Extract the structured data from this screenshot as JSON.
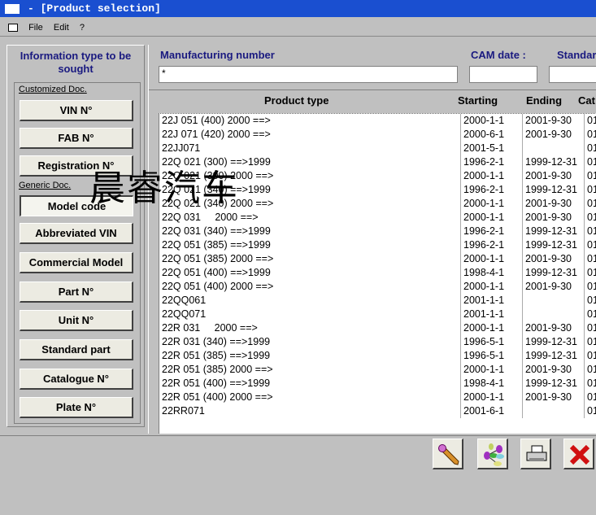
{
  "window": {
    "title": "- [Product selection]"
  },
  "menu": {
    "items": [
      "File",
      "Edit",
      "?"
    ]
  },
  "left_panel": {
    "title": "Information type to be sought",
    "customized_label": "Customized Doc.",
    "generic_label": "Generic Doc.",
    "customized_buttons": [
      "VIN N°",
      "FAB N°",
      "Registration N°"
    ],
    "generic_buttons": [
      "Model code",
      "Abbreviated VIN",
      "Commercial Model",
      "Part N°",
      "Unit N°",
      "Standard part",
      "Catalogue N°",
      "Plate N°"
    ],
    "selected": "Model code"
  },
  "search": {
    "manufacturing_number_label": "Manufacturing number",
    "manufacturing_number_value": "*",
    "cam_date_label": "CAM date :",
    "cam_date_value": "",
    "standard_label": "Standar",
    "standard_value": ""
  },
  "grid": {
    "headers": [
      "Product type",
      "Starting",
      "Ending",
      "Cat"
    ],
    "rows": [
      [
        "22J 051 (400) 2000 ==>",
        "2000-1-1",
        "2001-9-30",
        "01"
      ],
      [
        "22J 071 (420) 2000 ==>",
        "2000-6-1",
        "2001-9-30",
        "01"
      ],
      [
        "22JJ071",
        "2001-5-1",
        "",
        "01"
      ],
      [
        "22Q 021 (300) ==>1999",
        "1996-2-1",
        "1999-12-31",
        "01"
      ],
      [
        "22Q 021 (300) 2000 ==>",
        "2000-1-1",
        "2001-9-30",
        "01"
      ],
      [
        "22Q 021 (340) ==>1999",
        "1996-2-1",
        "1999-12-31",
        "01"
      ],
      [
        "22Q 021 (340) 2000 ==>",
        "2000-1-1",
        "2001-9-30",
        "01"
      ],
      [
        "22Q 031     2000 ==>",
        "2000-1-1",
        "2001-9-30",
        "01"
      ],
      [
        "22Q 031 (340) ==>1999",
        "1996-2-1",
        "1999-12-31",
        "01"
      ],
      [
        "22Q 051 (385) ==>1999",
        "1996-2-1",
        "1999-12-31",
        "01"
      ],
      [
        "22Q 051 (385) 2000 ==>",
        "2000-1-1",
        "2001-9-30",
        "01"
      ],
      [
        "22Q 051 (400) ==>1999",
        "1998-4-1",
        "1999-12-31",
        "01"
      ],
      [
        "22Q 051 (400) 2000 ==>",
        "2000-1-1",
        "2001-9-30",
        "01"
      ],
      [
        "22QQ061",
        "2001-1-1",
        "",
        "01"
      ],
      [
        "22QQ071",
        "2001-1-1",
        "",
        "01"
      ],
      [
        "22R 031     2000 ==>",
        "2000-1-1",
        "2001-9-30",
        "01"
      ],
      [
        "22R 031 (340) ==>1999",
        "1996-5-1",
        "1999-12-31",
        "01"
      ],
      [
        "22R 051 (385) ==>1999",
        "1996-5-1",
        "1999-12-31",
        "01"
      ],
      [
        "22R 051 (385) 2000 ==>",
        "2000-1-1",
        "2001-9-30",
        "01"
      ],
      [
        "22R 051 (400) ==>1999",
        "1998-4-1",
        "1999-12-31",
        "01"
      ],
      [
        "22R 051 (400) 2000 ==>",
        "2000-1-1",
        "2001-9-30",
        "01"
      ],
      [
        "22RR071",
        "2001-6-1",
        "",
        "01"
      ]
    ]
  },
  "toolbar": {
    "icons": [
      "pencil-icon",
      "network-icon",
      "printer-icon",
      "close-x-icon"
    ]
  },
  "watermark": "晨睿汽车",
  "colors": {
    "title_bar": "#1a4fd0",
    "label_blue": "#1a1a80",
    "close_red": "#d01010"
  }
}
